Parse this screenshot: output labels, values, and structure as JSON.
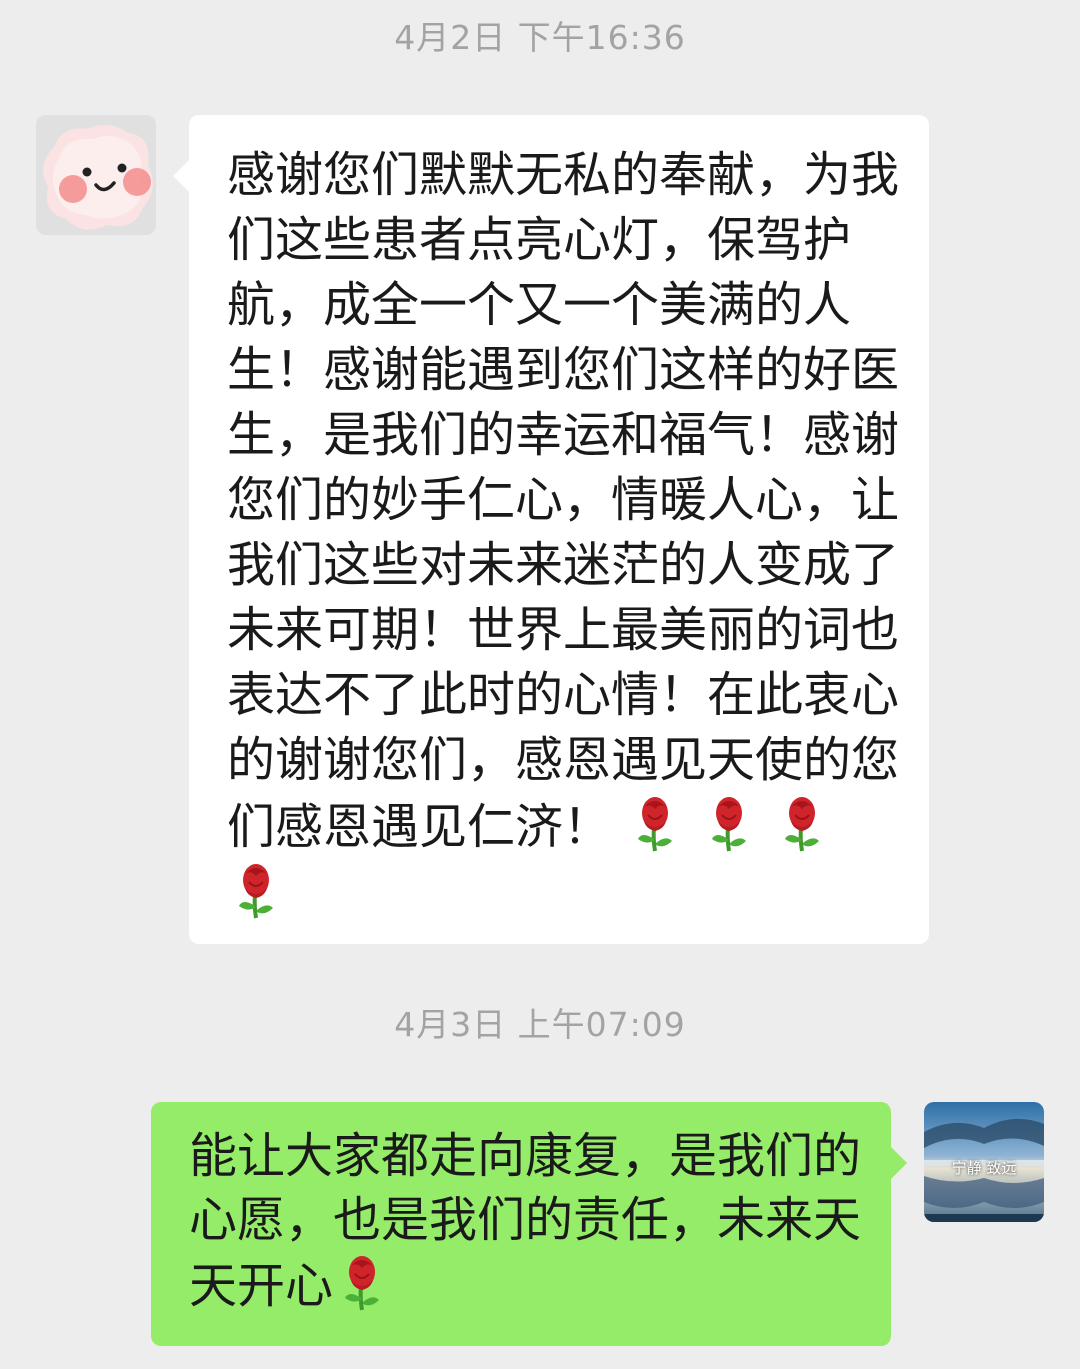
{
  "chat": {
    "timestamps": [
      "4月2日 下午16:36",
      "4月3日 上午07:09"
    ],
    "messages": [
      {
        "side": "left",
        "sender_avatar_icon": "pink-blush-face-avatar",
        "text": "感谢您们默默无私的奉献，为我们这些患者点亮心灯，保驾护航，成全一个又一个美满的人生！感谢能遇到您们这样的好医生，是我们的幸运和福气！感谢您们的妙手仁心，情暖人心，让我们这些对未来迷茫的人变成了未来可期！世界上最美丽的词也表达不了此时的心情！在此衷心的谢谢您们，感恩遇见天使的您们感恩遇见仁济！",
        "emoji": [
          "rose-emoji",
          "rose-emoji",
          "rose-emoji",
          "rose-emoji"
        ]
      },
      {
        "side": "right",
        "sender_avatar_icon": "lake-sunset-avatar",
        "avatar_text": "宁静 致远",
        "text": "能让大家都走向康复，是我们的心愿，也是我们的责任，未来天天开心",
        "emoji": [
          "rose-emoji"
        ]
      }
    ]
  },
  "colors": {
    "background": "#ededed",
    "incoming_bubble": "#ffffff",
    "outgoing_bubble": "#95ec69",
    "timestamp_text": "#a3a3a3"
  }
}
